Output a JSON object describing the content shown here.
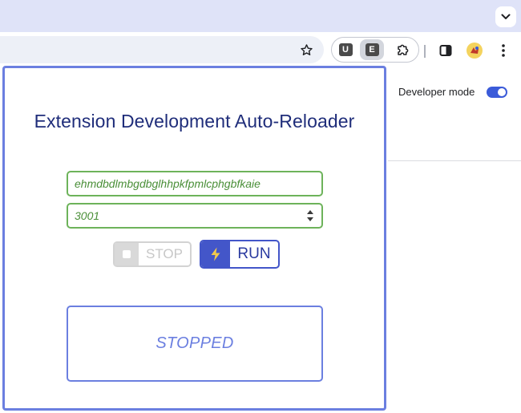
{
  "browser": {
    "extensions": [
      {
        "name": "extension-u",
        "label": "U"
      },
      {
        "name": "extension-e",
        "label": "E"
      }
    ]
  },
  "page": {
    "developer_mode_label": "Developer mode",
    "developer_mode_on": true
  },
  "popup": {
    "title": "Extension Development Auto-Reloader",
    "extension_id_value": "ehmdbdlmbgdbglhhpkfpmlcphgbfkaie",
    "port_value": "3001",
    "stop_label": "STOP",
    "run_label": "RUN",
    "status_text": "STOPPED"
  },
  "colors": {
    "accent": "#4356c9",
    "field_border": "#6db35a",
    "status": "#6b7fe0",
    "toggle": "#3b5bd9"
  }
}
